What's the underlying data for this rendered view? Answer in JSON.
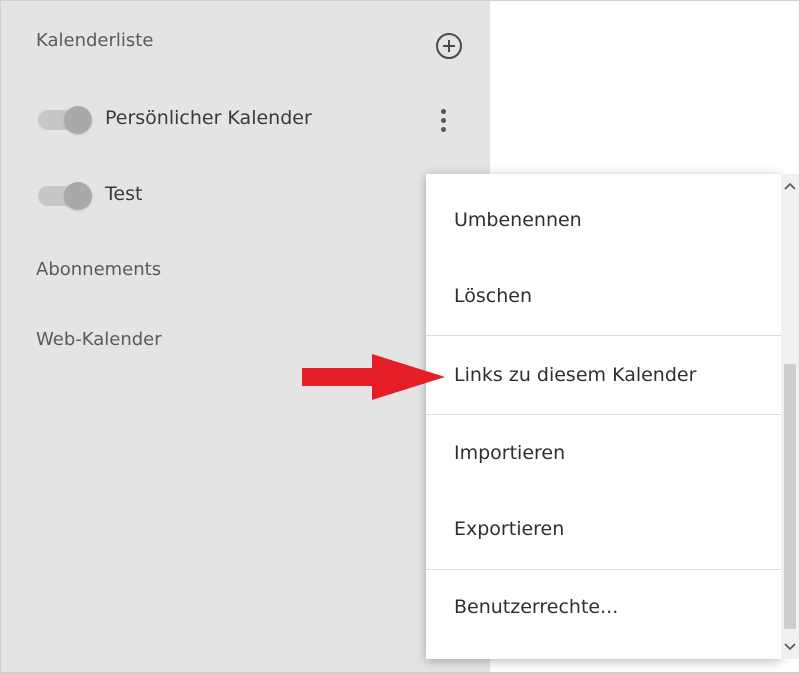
{
  "sidebar": {
    "calendar_list_title": "Kalenderliste",
    "calendars": [
      {
        "label": "Persönlicher Kalender",
        "enabled": true
      },
      {
        "label": "Test",
        "enabled": true
      }
    ],
    "subscriptions_title": "Abonnements",
    "web_calendar_title": "Web-Kalender"
  },
  "context_menu": {
    "items": [
      {
        "label": "Umbenennen"
      },
      {
        "label": "Löschen"
      },
      {
        "label": "Links zu diesem Kalender"
      },
      {
        "label": "Importieren"
      },
      {
        "label": "Exportieren"
      },
      {
        "label": "Benutzerrechte..."
      }
    ]
  },
  "icons": {
    "add": "plus-circle-icon",
    "menu": "vertical-dots-icon",
    "scroll_up": "chevron-up-icon",
    "scroll_down": "chevron-down-icon",
    "annotation": "red-arrow-icon"
  },
  "colors": {
    "sidebar_bg": "#e4e4e4",
    "annotation_arrow": "#e51e25"
  }
}
